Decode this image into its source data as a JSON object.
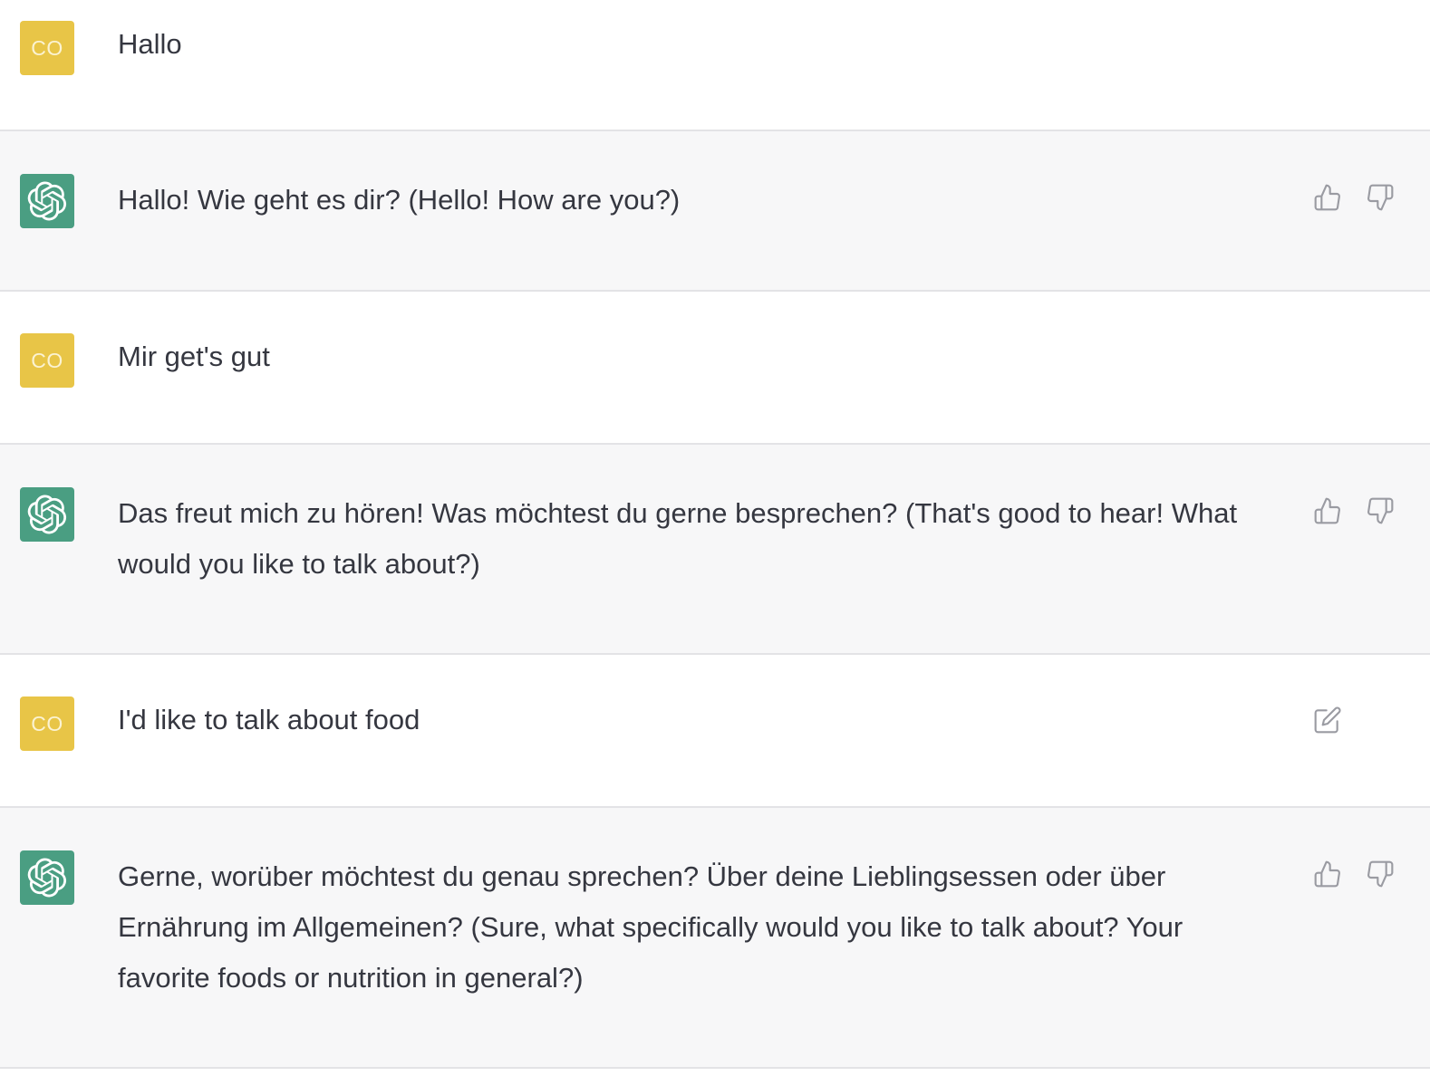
{
  "colors": {
    "user_avatar_bg": "#e8c547",
    "assistant_avatar_bg": "#4a9e82",
    "assistant_row_bg": "#f7f7f8",
    "user_row_bg": "#ffffff",
    "text": "#353740",
    "icon": "#9a9ba2"
  },
  "user": {
    "avatar_initials": "CO"
  },
  "messages": [
    {
      "role": "user",
      "text": "Hallo"
    },
    {
      "role": "assistant",
      "text": "Hallo! Wie geht es dir? (Hello! How are you?)",
      "actions": [
        "thumbs-up-icon",
        "thumbs-down-icon"
      ]
    },
    {
      "role": "user",
      "text": "Mir get's gut"
    },
    {
      "role": "assistant",
      "text": "Das freut mich zu hören! Was möchtest du gerne besprechen? (That's good to hear! What would you like to talk about?)",
      "actions": [
        "thumbs-up-icon",
        "thumbs-down-icon"
      ]
    },
    {
      "role": "user",
      "text": "I'd like to talk about food",
      "actions": [
        "edit-icon"
      ]
    },
    {
      "role": "assistant",
      "text": "Gerne, worüber möchtest du genau sprechen? Über deine Lieblingsessen oder über Ernährung im Allgemeinen? (Sure, what specifically would you like to talk about? Your favorite foods or nutrition in general?)",
      "actions": [
        "thumbs-up-icon",
        "thumbs-down-icon"
      ]
    }
  ]
}
